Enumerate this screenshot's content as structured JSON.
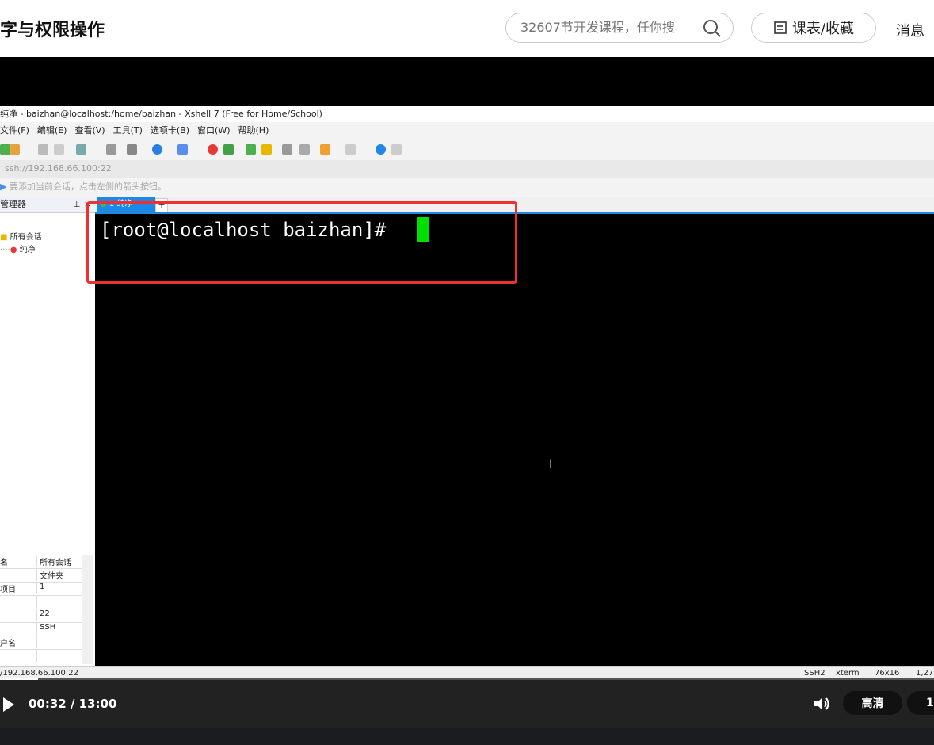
{
  "header": {
    "course_title": "字与权限操作",
    "search_placeholder": "32607节开发课程，任你搜",
    "course_button_label": "课表/收藏",
    "messages_label": "消息"
  },
  "xshell": {
    "window_title": "纯净 - baizhan@localhost:/home/baizhan - Xshell 7 (Free for Home/School)",
    "menu": [
      "文件(F)",
      "编辑(E)",
      "查看(V)",
      "工具(T)",
      "选项卡(B)",
      "窗口(W)",
      "帮助(H)"
    ],
    "address": "ssh://192.168.66.100:22",
    "hint": "要添加当前会话，点击左侧的箭头按钮。",
    "session_panel_title": "管理器",
    "tree_root": "所有会话",
    "tree_child": "纯净",
    "tab_label": "1 纯净",
    "tab_add": "+",
    "prompt": "[root@localhost baizhan]# ",
    "properties": [
      {
        "key": "名",
        "value": "所有会话"
      },
      {
        "key": "",
        "value": "文件夹"
      },
      {
        "key": "项目",
        "value": "1"
      },
      {
        "key": "",
        "value": ""
      },
      {
        "key": "",
        "value": "22"
      },
      {
        "key": "",
        "value": "SSH"
      },
      {
        "key": "户名",
        "value": ""
      },
      {
        "key": "",
        "value": ""
      }
    ],
    "status": {
      "address": "/192.168.66.100:22",
      "protocol": "SSH2",
      "term": "xterm",
      "size": "76x16",
      "pos": "1,27"
    }
  },
  "player": {
    "time": "00:32 / 13:00",
    "quality_label": "高清",
    "speed_label": "1.",
    "progress": 0.041
  }
}
